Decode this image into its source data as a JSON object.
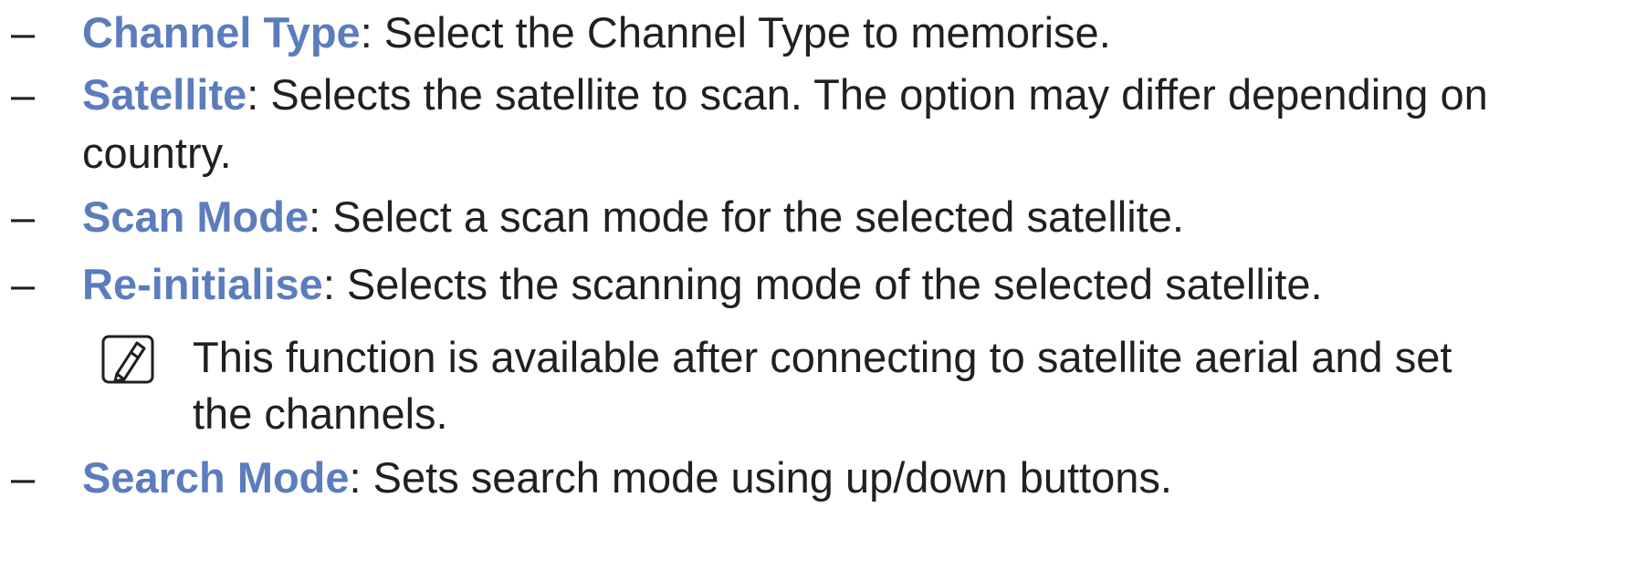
{
  "items": [
    {
      "dash": "–",
      "term": "Channel Type",
      "desc_line1": ": Select the Channel Type to memorise."
    },
    {
      "dash": "–",
      "term": "Satellite",
      "desc_line1": ": Selects the satellite to scan. The option may differ depending on",
      "desc_line2": "country."
    },
    {
      "dash": "–",
      "term": "Scan Mode",
      "desc_line1": ": Select a scan mode for the selected satellite."
    },
    {
      "dash": "–",
      "term": "Re-initialise",
      "desc_line1": ": Selects the scanning mode of the selected satellite."
    },
    {
      "dash": "–",
      "term": "Search Mode",
      "desc_line1": ": Sets search mode using up/down buttons."
    }
  ],
  "note": {
    "icon": "note-icon",
    "line1": "This function is available after connecting to satellite aerial and set",
    "line2": "the channels."
  },
  "colors": {
    "term": "#5b7dbe",
    "text": "#231f20"
  }
}
